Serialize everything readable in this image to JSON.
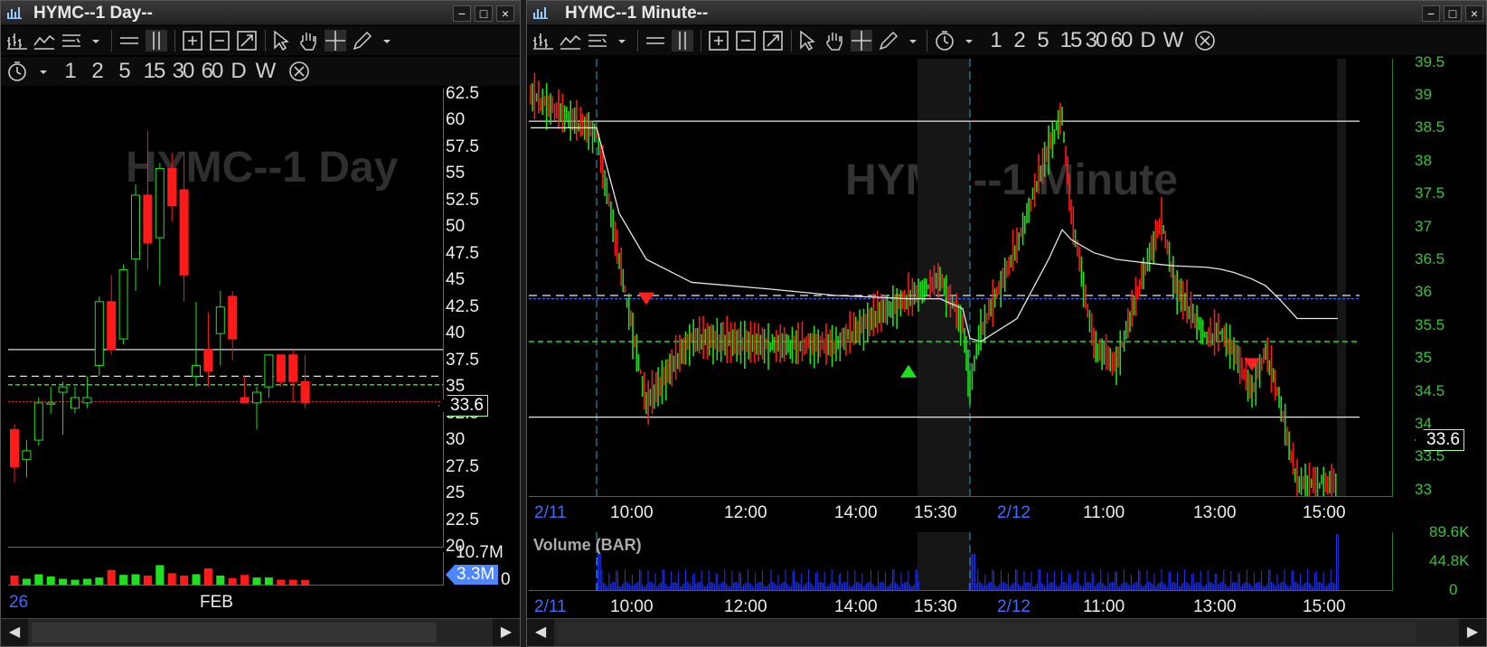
{
  "windows": {
    "daily": {
      "title": "HYMC--1 Day--",
      "watermark": "HYMC--1 Day",
      "y_labels": [
        "62.5",
        "60",
        "57.5",
        "55",
        "52.5",
        "50",
        "47.5",
        "45",
        "42.5",
        "40",
        "37.5",
        "35",
        "32.5",
        "30",
        "27.5",
        "25",
        "22.5",
        "20"
      ],
      "price_tag": "33.6",
      "volume_max": "10.7M",
      "volume_tag": "3.3M",
      "volume_zero": "0",
      "x_labels": [
        "26",
        "FEB"
      ]
    },
    "minute": {
      "title": "HYMC--1 Minute--",
      "watermark": "HYMC--1 Minute",
      "y_labels": [
        "39.5",
        "39",
        "38.5",
        "38",
        "37.5",
        "37",
        "36.5",
        "36",
        "35.5",
        "35",
        "34.5",
        "34",
        "33.5",
        "33"
      ],
      "price_tag": "33.6",
      "volume_label": "Volume (BAR)",
      "volume_labels": [
        "89.6K",
        "44.8K",
        "0"
      ],
      "x_labels": [
        "2/11",
        "10:00",
        "12:00",
        "14:00",
        "15:30",
        "2/12",
        "11:00",
        "13:00",
        "15:00"
      ]
    }
  },
  "toolbar": {
    "window_buttons": [
      "−",
      "□",
      "×"
    ],
    "icons": [
      "bar-chart-icon",
      "line-chart-icon",
      "indicator-list-icon",
      "dropdown-icon",
      "horizontal-lines-icon",
      "vertical-lines-icon",
      "zoom-in-icon",
      "zoom-out-icon",
      "zoom-fit-icon",
      "pointer-icon",
      "hand-icon",
      "crosshair-icon",
      "pencil-icon",
      "dropdown-icon"
    ],
    "timeframe_icon": "clock-icon",
    "timeframes": [
      "1",
      "2",
      "5",
      "15",
      "30",
      "60",
      "D",
      "W"
    ],
    "cancel_icon": "cancel-circle-icon"
  },
  "colors": {
    "up": "#1ee01e",
    "down": "#ff1a1a",
    "dash_green": "#22dd22",
    "dash_blue": "#3366ff",
    "axis_green": "#2fbf2f",
    "volume_blue": "#2233ff",
    "white_line": "#ffffff"
  },
  "chart_data": [
    {
      "type": "candlestick",
      "title": "HYMC--1 Day",
      "ylim": [
        20,
        63
      ],
      "candles": [
        {
          "o": 31,
          "h": 31.5,
          "l": 26,
          "c": 27.5
        },
        {
          "o": 28.2,
          "h": 30,
          "l": 26.5,
          "c": 29
        },
        {
          "o": 30,
          "h": 34,
          "l": 29.5,
          "c": 33.5
        },
        {
          "o": 33.5,
          "h": 35,
          "l": 32.5,
          "c": 33.5
        },
        {
          "o": 34.5,
          "h": 35.5,
          "l": 30.5,
          "c": 35
        },
        {
          "o": 33,
          "h": 35,
          "l": 32.5,
          "c": 34
        },
        {
          "o": 33.5,
          "h": 36,
          "l": 33,
          "c": 34
        },
        {
          "o": 37,
          "h": 43.5,
          "l": 36,
          "c": 43
        },
        {
          "o": 43,
          "h": 45.5,
          "l": 38,
          "c": 38.5
        },
        {
          "o": 39.5,
          "h": 46.5,
          "l": 39,
          "c": 46
        },
        {
          "o": 47,
          "h": 54,
          "l": 44,
          "c": 53
        },
        {
          "o": 53,
          "h": 59,
          "l": 46,
          "c": 48.5
        },
        {
          "o": 49,
          "h": 56,
          "l": 44.5,
          "c": 55.5
        },
        {
          "o": 55.5,
          "h": 57,
          "l": 50.5,
          "c": 52
        },
        {
          "o": 53.5,
          "h": 57,
          "l": 43,
          "c": 45.5
        },
        {
          "o": 36,
          "h": 43,
          "l": 35,
          "c": 37
        },
        {
          "o": 38.5,
          "h": 42,
          "l": 35,
          "c": 36.5
        },
        {
          "o": 40,
          "h": 44,
          "l": 37,
          "c": 42.5
        },
        {
          "o": 43.5,
          "h": 44,
          "l": 37.5,
          "c": 39.5
        },
        {
          "o": 34,
          "h": 36,
          "l": 33.5,
          "c": 33.5
        },
        {
          "o": 33.5,
          "h": 35,
          "l": 31,
          "c": 34.5
        },
        {
          "o": 35,
          "h": 38,
          "l": 34,
          "c": 38
        },
        {
          "o": 38,
          "h": 38,
          "l": 35,
          "c": 35.5
        },
        {
          "o": 38,
          "h": 38.5,
          "l": 33.5,
          "c": 35.5
        },
        {
          "o": 35.5,
          "h": 38,
          "l": 33,
          "c": 33.5
        }
      ],
      "volume": [
        0.28,
        0.18,
        0.32,
        0.25,
        0.18,
        0.15,
        0.18,
        0.22,
        0.45,
        0.3,
        0.32,
        0.28,
        0.6,
        0.35,
        0.28,
        0.32,
        0.5,
        0.28,
        0.2,
        0.3,
        0.22,
        0.22,
        0.15,
        0.15,
        0.14
      ],
      "levels": {
        "solid": [
          38.5
        ],
        "dashed_white": [
          36
        ],
        "dashed_green": [
          35.2
        ],
        "dashed_red": [
          33.6
        ]
      }
    },
    {
      "type": "line",
      "title": "HYMC--1 Minute",
      "ylim": [
        32.9,
        39.55
      ],
      "x": [
        "2/11 09:30",
        "10:00",
        "10:30",
        "11:00",
        "12:00",
        "13:00",
        "14:00",
        "14:30",
        "15:00",
        "15:30",
        "15:58",
        "2/12 09:30",
        "09:45",
        "10:15",
        "10:45",
        "11:00",
        "11:15",
        "11:30",
        "12:00",
        "12:30",
        "12:45",
        "13:00",
        "13:30",
        "14:00",
        "14:30",
        "14:50",
        "15:00",
        "15:15",
        "15:30",
        "15:58"
      ],
      "series": [
        {
          "name": "Price",
          "values": [
            39.0,
            38.4,
            36.5,
            34.3,
            35.3,
            35.2,
            35.2,
            35.7,
            35.9,
            36.2,
            35.5,
            34.6,
            35.4,
            36.7,
            38.2,
            38.7,
            37.2,
            35.2,
            34.9,
            36.3,
            37.1,
            36.1,
            35.3,
            35.4,
            35.1,
            34.5,
            35.1,
            34.4,
            33.1,
            33.1
          ]
        },
        {
          "name": "VWAP",
          "values": [
            38.5,
            38.5,
            37.2,
            36.5,
            36.15,
            36.05,
            35.95,
            35.92,
            35.9,
            35.9,
            35.75,
            35.3,
            35.25,
            35.6,
            36.5,
            36.95,
            36.8,
            36.6,
            36.5,
            36.45,
            36.42,
            36.4,
            36.38,
            36.35,
            36.3,
            36.2,
            36.1,
            35.9,
            35.6,
            35.6
          ]
        }
      ],
      "levels": {
        "solid": [
          38.6,
          34.1
        ],
        "dashed_white": [
          35.95
        ],
        "dashed_blue": [
          35.9
        ],
        "dashed_green": [
          35.25
        ]
      },
      "markers": [
        {
          "x": "11:00",
          "type": "sell",
          "value": 35.9
        },
        {
          "x": "14:50",
          "type": "sell",
          "value": 34.9
        },
        {
          "x": "15:00",
          "type": "buy",
          "value": 34.8
        }
      ]
    }
  ]
}
